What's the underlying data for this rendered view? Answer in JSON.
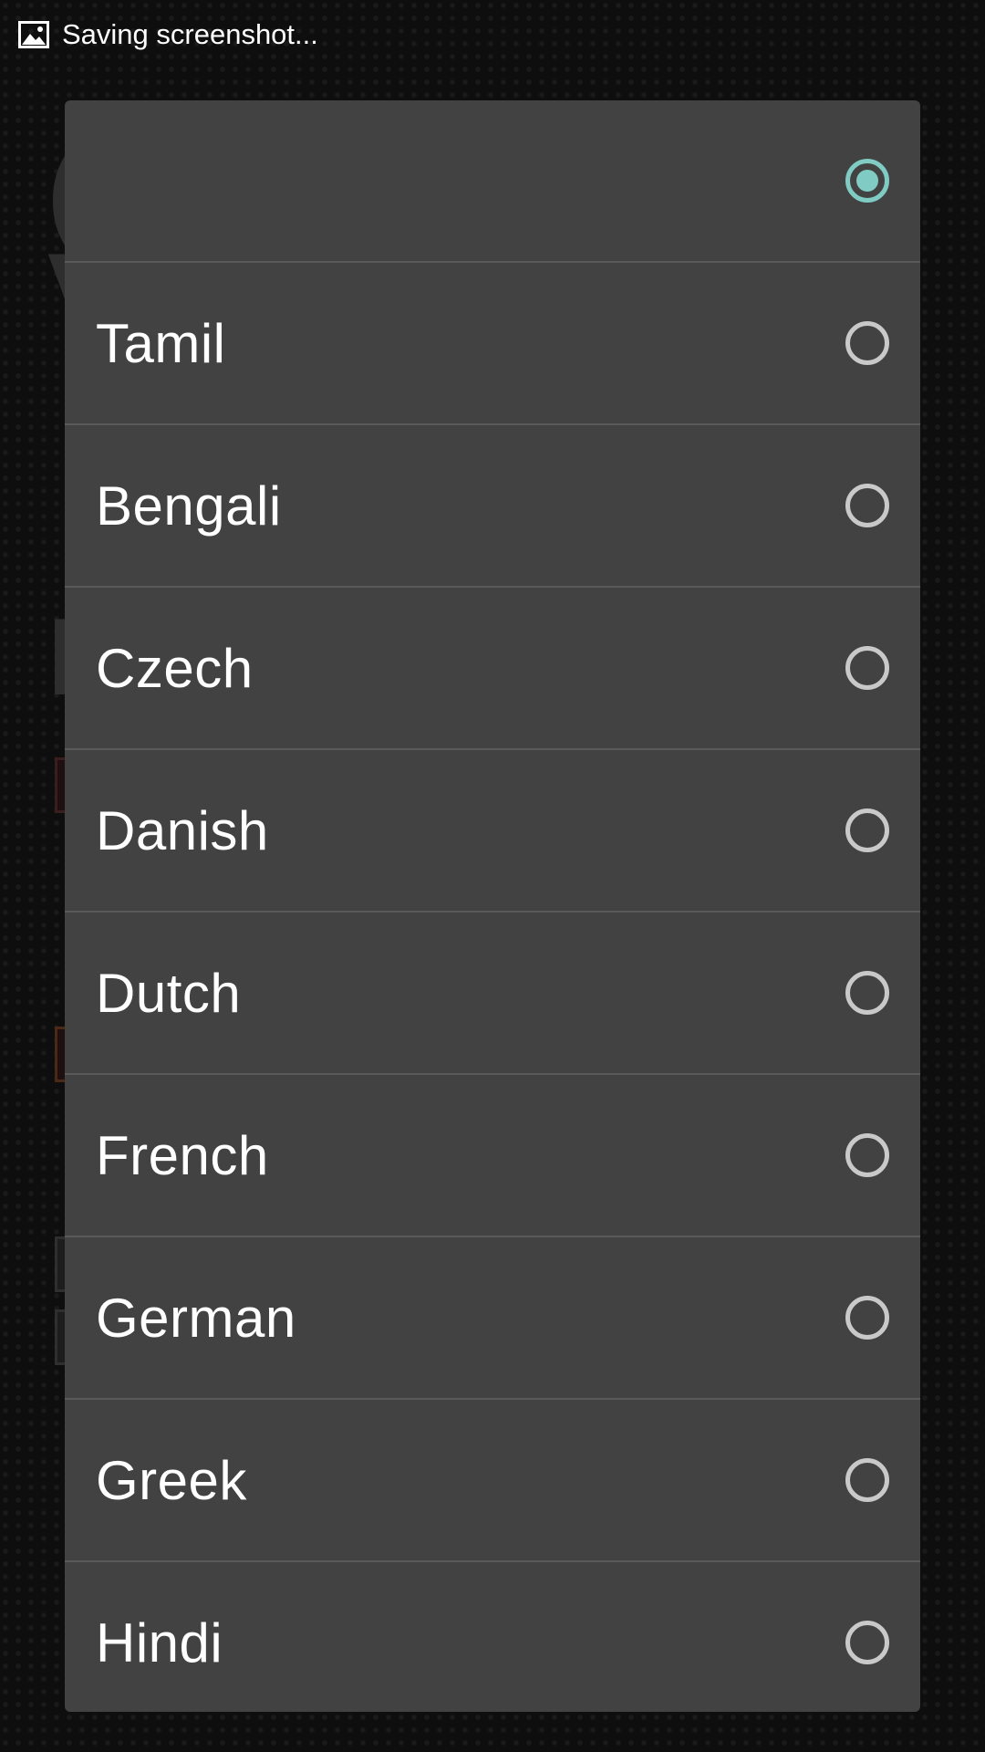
{
  "status_bar": {
    "icon": "image-icon",
    "text": "Saving screenshot..."
  },
  "dialog": {
    "options": [
      {
        "label": "",
        "selected": true
      },
      {
        "label": "Tamil",
        "selected": false
      },
      {
        "label": "Bengali",
        "selected": false
      },
      {
        "label": "Czech",
        "selected": false
      },
      {
        "label": "Danish",
        "selected": false
      },
      {
        "label": "Dutch",
        "selected": false
      },
      {
        "label": "French",
        "selected": false
      },
      {
        "label": "German",
        "selected": false
      },
      {
        "label": "Greek",
        "selected": false
      },
      {
        "label": "Hindi",
        "selected": false
      }
    ]
  },
  "colors": {
    "dialog_bg": "#424242",
    "radio_selected": "#80cbc4",
    "radio_unselected": "#c9c9c9",
    "divider": "#5a5a5a"
  }
}
